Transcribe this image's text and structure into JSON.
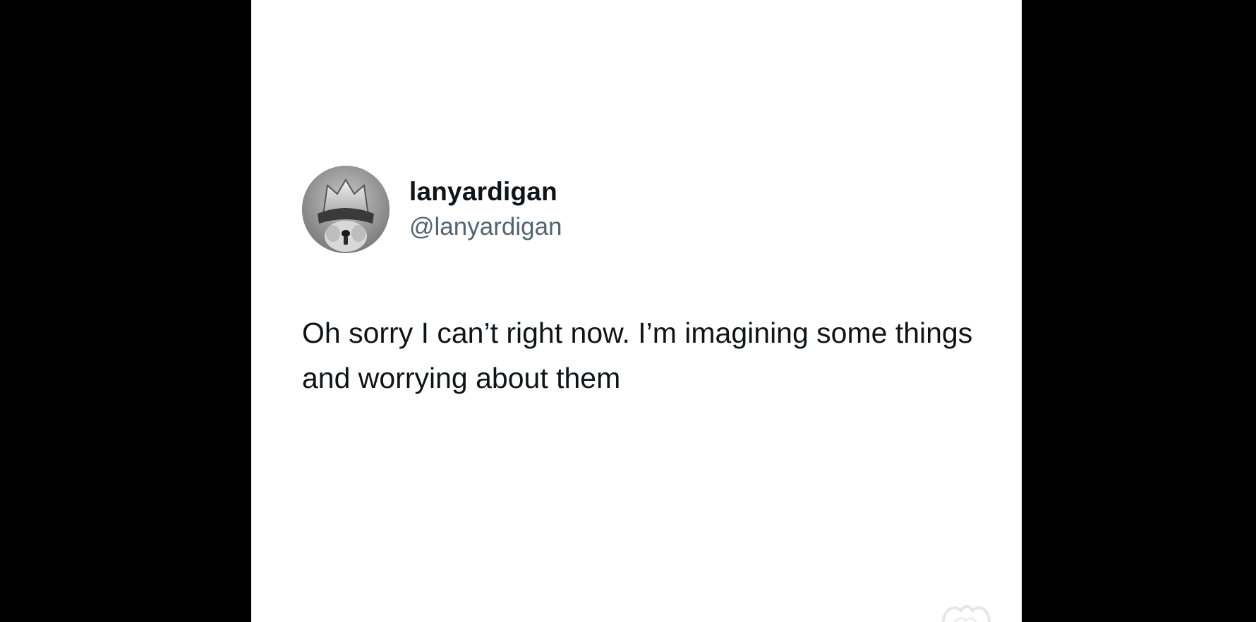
{
  "tweet": {
    "display_name": "lanyardigan",
    "handle": "@lanyardigan",
    "text": "Oh sorry I can’t right now. I’m imagining some things and worrying about them",
    "avatar_icon": "helmeted-dog-avatar",
    "watermark_icon": "meme-watermark-icon"
  },
  "colors": {
    "card_background": "#ffffff",
    "letterbox": "#000000",
    "primary_text": "#0f1419",
    "secondary_text": "#536471"
  }
}
